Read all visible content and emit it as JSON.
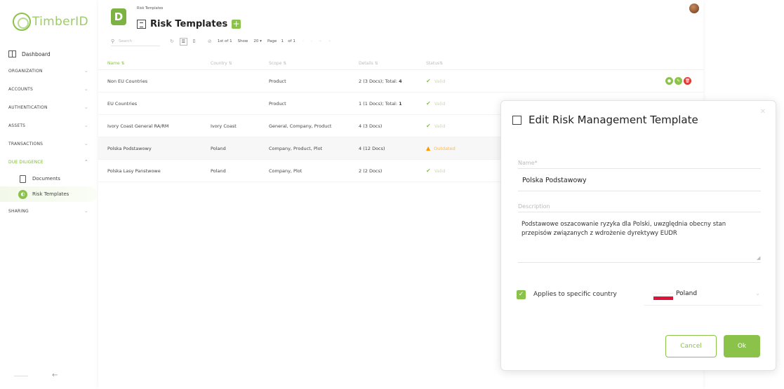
{
  "brand": {
    "name": "TimberID",
    "tile_letter": "D"
  },
  "sidebar": {
    "dashboard": "Dashboard",
    "sections": [
      {
        "label": "ORGANIZATION"
      },
      {
        "label": "ACCOUNTS"
      },
      {
        "label": "AUTHENTICATION"
      },
      {
        "label": "ASSETS"
      },
      {
        "label": "TRANSACTIONS"
      },
      {
        "label": "DUE DILIGENCE"
      },
      {
        "label": "SHARING"
      }
    ],
    "sub_items": [
      {
        "label": "Documents"
      },
      {
        "label": "Risk Templates"
      }
    ],
    "collapse_arrow": "←"
  },
  "header": {
    "breadcrumb": "Risk Templates",
    "title": "Risk Templates",
    "add_label": "+"
  },
  "toolbar": {
    "search_placeholder": "Search",
    "range": "1st of 1",
    "show_label": "Show",
    "show_value": "20",
    "page_label": "Page",
    "page_value": "1",
    "page_total": "of 1"
  },
  "table": {
    "headers": [
      "Name",
      "Country",
      "Scope",
      "Details",
      "Status"
    ],
    "rows": [
      {
        "name": "Non EU Countries",
        "country": "",
        "scope": "Product",
        "details": "2 (3 Docs); Total: ",
        "details_bold": "4",
        "status": "Valid",
        "status_type": "valid"
      },
      {
        "name": "EU Countries",
        "country": "",
        "scope": "Product",
        "details": "1 (1 Docs); Total: ",
        "details_bold": "1",
        "status": "Valid",
        "status_type": "valid"
      },
      {
        "name": "Ivory Coast General RA/RM",
        "country": "Ivory Coast",
        "scope": "General, Company, Product",
        "details": "4 (3 Docs)",
        "details_bold": "",
        "status": "Valid",
        "status_type": "valid"
      },
      {
        "name": "Polska Podstawowy",
        "country": "Poland",
        "scope": "Company, Product, Plot",
        "details": "4 (12 Docs)",
        "details_bold": "",
        "status": "Outdated",
        "status_type": "outdated"
      },
      {
        "name": "Polska Lasy Panstwowe",
        "country": "Poland",
        "scope": "Company, Plot",
        "details": "2 (2 Docs)",
        "details_bold": "",
        "status": "Valid",
        "status_type": "valid"
      }
    ]
  },
  "modal": {
    "title": "Edit Risk Management Template",
    "name_label": "Name*",
    "name_value": "Polska Podstawowy",
    "description_label": "Description",
    "description_value": "Podstawowe oszacowanie ryzyka dla Polski, uwzględnia obecny stan przepisów związanych z wdrożenie dyrektywy EUDR",
    "applies_label": "Applies to specific country",
    "country_value": "Poland",
    "cancel_label": "Cancel",
    "ok_label": "Ok"
  },
  "colors": {
    "accent": "#8bc34a",
    "danger": "#e53935",
    "warning": "#ff9800"
  }
}
